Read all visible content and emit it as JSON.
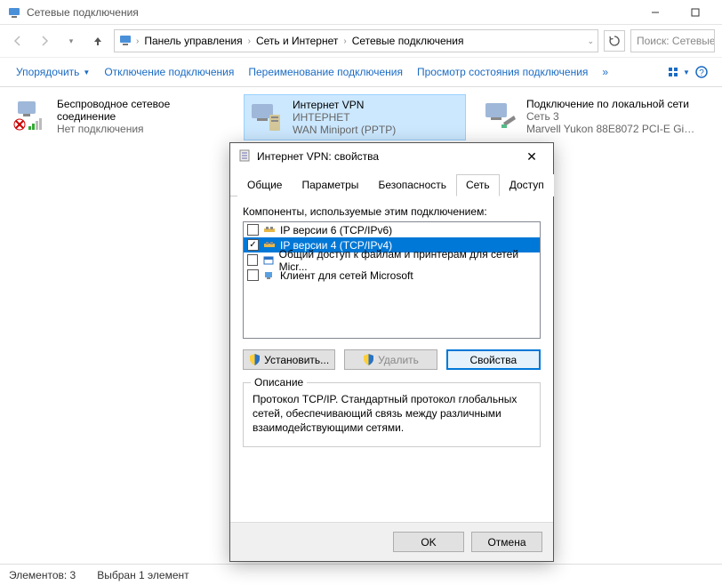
{
  "window": {
    "title": "Сетевые подключения"
  },
  "breadcrumb": {
    "items": [
      "Панель управления",
      "Сеть и Интернет",
      "Сетевые подключения"
    ]
  },
  "search": {
    "placeholder": "Поиск: Сетевые подключения"
  },
  "toolbar": {
    "organize": "Упорядочить",
    "disable": "Отключение подключения",
    "rename": "Переименование подключения",
    "status": "Просмотр состояния подключения"
  },
  "connections": [
    {
      "title": "Беспроводное сетевое соединение",
      "line2": "",
      "line3": "Нет подключения"
    },
    {
      "title": "Интернет  VPN",
      "line2": "ИНТЕРНЕТ",
      "line3": "WAN Miniport (PPTP)"
    },
    {
      "title": "Подключение по локальной сети",
      "line2": "Сеть 3",
      "line3": "Marvell Yukon 88E8072 PCI-E Gig..."
    }
  ],
  "statusbar": {
    "count": "Элементов: 3",
    "selected": "Выбран 1 элемент"
  },
  "dialog": {
    "title": "Интернет  VPN: свойства",
    "tabs": [
      "Общие",
      "Параметры",
      "Безопасность",
      "Сеть",
      "Доступ"
    ],
    "active_tab": "Сеть",
    "list_label": "Компоненты, используемые этим подключением:",
    "components": [
      {
        "checked": false,
        "label": "IP версии 6 (TCP/IPv6)",
        "selected": false
      },
      {
        "checked": true,
        "label": "IP версии 4 (TCP/IPv4)",
        "selected": true
      },
      {
        "checked": false,
        "label": "Общий доступ к файлам и принтерам для сетей Micr...",
        "selected": false
      },
      {
        "checked": false,
        "label": "Клиент для сетей Microsoft",
        "selected": false
      }
    ],
    "buttons": {
      "install": "Установить...",
      "uninstall": "Удалить",
      "properties": "Свойства"
    },
    "group_legend": "Описание",
    "description": "Протокол TCP/IP. Стандартный протокол глобальных сетей, обеспечивающий связь между различными взаимодействующими сетями.",
    "footer": {
      "ok": "OK",
      "cancel": "Отмена"
    }
  }
}
